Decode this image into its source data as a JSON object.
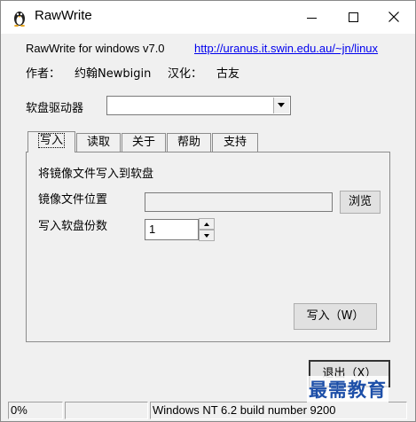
{
  "window": {
    "title": "RawWrite",
    "app_icon": "penguin-icon"
  },
  "header": {
    "version": "RawWrite for windows v7.0",
    "url": "http://uranus.it.swin.edu.au/~jn/linux",
    "author_label": "作者：",
    "author": "约翰Newbigin",
    "translator_label": "汉化：",
    "translator": "古友"
  },
  "drive": {
    "label": "软盘驱动器",
    "value": ""
  },
  "tabs": [
    {
      "label": "写入",
      "active": true
    },
    {
      "label": "读取",
      "active": false
    },
    {
      "label": "关于",
      "active": false
    },
    {
      "label": "帮助",
      "active": false
    },
    {
      "label": "支持",
      "active": false
    }
  ],
  "write_tab": {
    "heading": "将镜像文件写入到软盘",
    "image_label": "镜像文件位置",
    "image_value": "",
    "browse_button": "浏览",
    "copies_label": "写入软盘份数",
    "copies_value": "1",
    "write_button": "写入（W）"
  },
  "exit_button": "退出（X）",
  "status_bar": {
    "progress": "0%",
    "middle": "",
    "os": "Windows NT 6.2 build number 9200"
  },
  "watermark": "最需教育"
}
